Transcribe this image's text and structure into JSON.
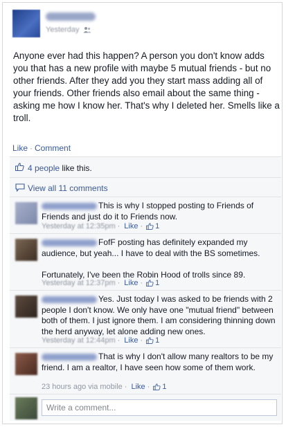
{
  "post": {
    "timestamp": "Yesterday",
    "privacy_icon": "friends-icon",
    "text": "Anyone ever had this happen? A person you don't know adds you that has a new profile with maybe 5 mutual friends - but no other friends. After they add you they start mass adding all of your friends. Other friends also email about the same thing - asking me how I know her. That's why I deleted her. Smells like a troll.",
    "actions": {
      "like_label": "Like",
      "separator": "·",
      "comment_label": "Comment"
    }
  },
  "likes": {
    "icon": "thumbs-up-icon",
    "count_label": "4 people",
    "suffix": " like this."
  },
  "view_all": {
    "icon": "comment-bubble-icon",
    "label": "View all 11 comments"
  },
  "comments": [
    {
      "text": "This is why I stopped posting to Friends of Friends and just do it to Friends now.",
      "time": "Yesterday at 12:35pm",
      "like_label": "Like",
      "like_count": "1",
      "avatar_color": "#8894b8"
    },
    {
      "text": "FofF posting has definitely expanded my audience, but yeah... I have to deal with the BS sometimes.",
      "text2": "Fortunately, I've been the Robin Hood of trolls since 89.",
      "time": "Yesterday at 12:37pm",
      "like_label": "Like",
      "like_count": "1",
      "avatar_color": "#5a4636"
    },
    {
      "text": "Yes. Just today I was asked to be friends with 2 people I don't know. We only have one \"mutual friend\" between both of them. I just ignore them. I am considering thinning down the herd anyway, let alone adding new ones.",
      "time": "Yesterday at 12:44pm",
      "like_label": "Like",
      "like_count": "1",
      "avatar_color": "#4a3a30"
    },
    {
      "text": "That is why I don't allow many realtors to be my friend. I am a realtor, I have seen how some of them work.",
      "time": "23 hours ago via mobile",
      "like_label": "Like",
      "like_count": "1",
      "avatar_color": "#6a3a2a"
    }
  ],
  "composer": {
    "placeholder": "Write a comment..."
  },
  "colors": {
    "link": "#3b5998",
    "meta": "#9197a3",
    "ufi_bg": "#f6f7f8"
  }
}
